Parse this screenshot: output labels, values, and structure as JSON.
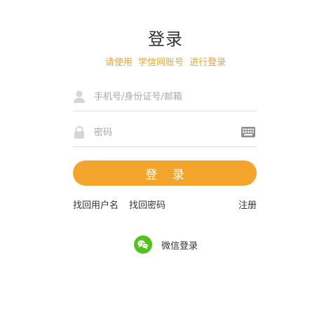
{
  "colors": {
    "accent": "#f2a42d",
    "subtitle": "#e0a43f",
    "wechat_green": "#53c21d",
    "icon_gray": "#d6d6d6"
  },
  "header": {
    "title": "登录",
    "subtitle_parts": [
      "请使用",
      "学信网账号",
      "进行登录"
    ]
  },
  "form": {
    "username": {
      "placeholder": "手机号/身份证号/邮箱",
      "value": "",
      "icon": "user-icon"
    },
    "password": {
      "placeholder": "密码",
      "value": "",
      "icon": "lock-icon",
      "trailing_icon": "keyboard-icon"
    },
    "submit_label": "登 录"
  },
  "links": {
    "find_username": "找回用户名",
    "find_password": "找回密码",
    "register": "注册"
  },
  "social": {
    "wechat_label": "微信登录",
    "icon": "wechat-icon"
  }
}
